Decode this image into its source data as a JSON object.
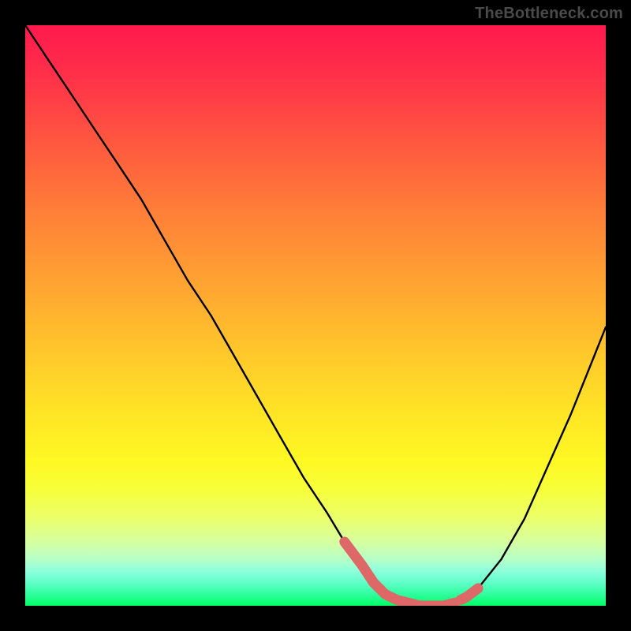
{
  "attribution": "TheBottleneck.com",
  "chart_data": {
    "type": "line",
    "title": "",
    "xlabel": "",
    "ylabel": "",
    "xlim": [
      0,
      100
    ],
    "ylim": [
      0,
      100
    ],
    "legend": false,
    "grid": false,
    "series": [
      {
        "name": "bottleneck-curve",
        "color": "#000000",
        "x": [
          0,
          4,
          8,
          12,
          16,
          20,
          24,
          28,
          32,
          36,
          40,
          44,
          48,
          52,
          55,
          58,
          60,
          62,
          64,
          67,
          70,
          72,
          75,
          78,
          82,
          86,
          90,
          94,
          98,
          100
        ],
        "values": [
          100,
          94,
          88,
          82,
          76,
          70,
          63,
          56,
          50,
          43,
          36,
          29,
          22,
          16,
          11,
          7,
          4,
          2,
          1,
          0,
          0,
          0,
          1,
          3,
          8,
          15,
          24,
          33,
          43,
          48
        ]
      },
      {
        "name": "optimal-band",
        "color": "#e06a6a",
        "x": [
          55,
          58,
          60,
          62,
          64,
          66,
          68,
          70,
          72,
          74,
          75,
          76,
          78
        ],
        "values": [
          11,
          7,
          4,
          2,
          1,
          0.5,
          0,
          0,
          0,
          0.5,
          1,
          1.5,
          3
        ]
      }
    ],
    "annotations": []
  },
  "colors": {
    "background": "#000000",
    "gradient_top": "#ff1a4d",
    "gradient_bottom": "#00ff66",
    "curve": "#000000",
    "optimal_marker": "#e06a6a"
  }
}
